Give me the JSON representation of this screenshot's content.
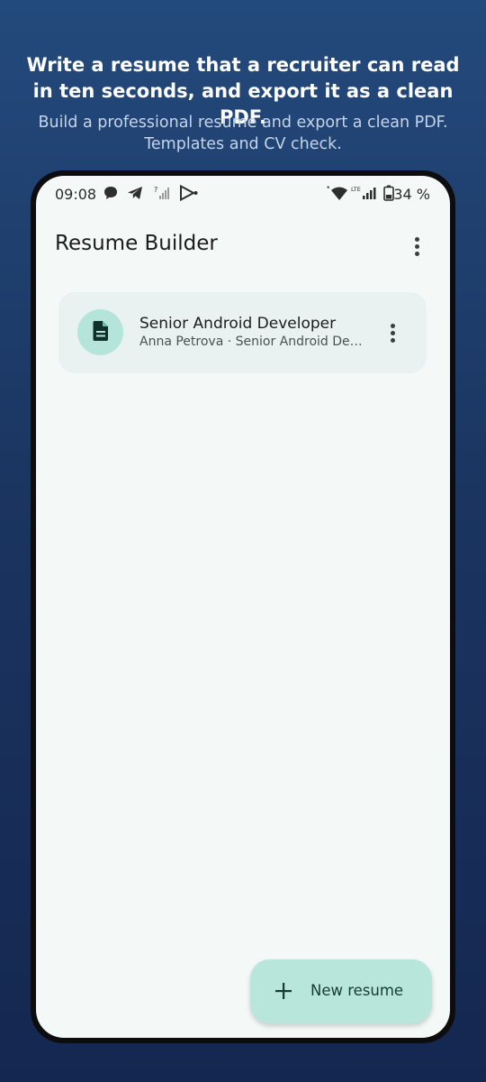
{
  "promo": {
    "title": "Write a resume that a recruiter can read in ten seconds, and export it as a clean PDF.",
    "subtitle": "Build a professional resume and export a clean PDF. Templates and CV check."
  },
  "status_bar": {
    "time": "09:08",
    "battery": "34 %",
    "icons": [
      "chat-bubble-icon",
      "telegram-icon",
      "signal-question-icon",
      "play-store-icon",
      "wifi-icon",
      "lte-signal-icon",
      "battery-icon"
    ]
  },
  "app_bar": {
    "title": "Resume Builder"
  },
  "resumes": [
    {
      "title": "Senior Android Developer",
      "subtitle": "Anna Petrova · Senior Android Developer",
      "icon": "document-icon"
    }
  ],
  "fab": {
    "label": "New resume",
    "icon": "plus-icon"
  },
  "colors": {
    "background_top": "#234a7c",
    "background_bottom": "#142750",
    "screen": "#f4f8f7",
    "card": "#e9f2f1",
    "accent": "#b8e6db",
    "avatar": "#b4e4da"
  }
}
